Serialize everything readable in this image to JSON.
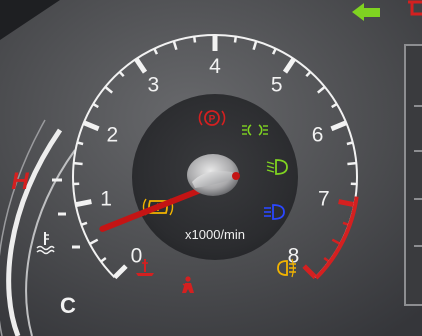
{
  "tachometer": {
    "unit_label": "x1000/min",
    "scale_min": 0,
    "scale_max": 8,
    "redline_start": 6.9,
    "needle_value": 0.6,
    "tick_labels": [
      "0",
      "1",
      "2",
      "3",
      "4",
      "5",
      "6",
      "7",
      "8"
    ]
  },
  "temp_gauge": {
    "hot_label": "H",
    "cold_label": "C"
  },
  "colors": {
    "accent_red": "#d42020",
    "warning_amber": "#f2b400",
    "indicator_green": "#7fd321",
    "high_beam_blue": "#2a47ff",
    "scale_white": "#f2f2f2"
  },
  "indicators": [
    {
      "name": "parking-brake-warning-icon",
      "color": "red"
    },
    {
      "name": "side-lights-indicator-icon",
      "color": "green"
    },
    {
      "name": "low-beam-indicator-icon",
      "color": "green"
    },
    {
      "name": "high-beam-indicator-icon",
      "color": "blue"
    },
    {
      "name": "rear-fog-light-icon",
      "color": "amber"
    },
    {
      "name": "tpms-warning-icon",
      "color": "amber"
    },
    {
      "name": "oil-pressure-warning-icon",
      "color": "red"
    },
    {
      "name": "seatbelt-warning-icon",
      "color": "red"
    },
    {
      "name": "coolant-temperature-icon",
      "color": "white"
    },
    {
      "name": "turn-signal-left-icon",
      "color": "green"
    }
  ]
}
